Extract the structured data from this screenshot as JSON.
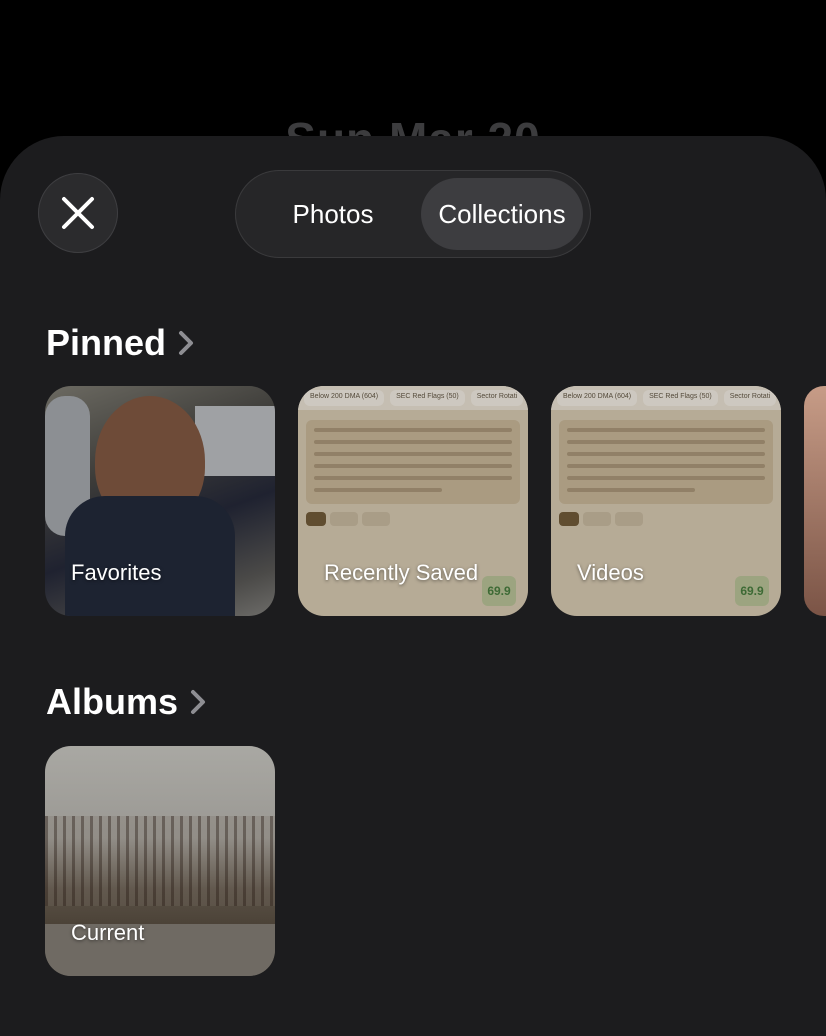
{
  "background": {
    "date_text": "Sun Mar 20"
  },
  "header": {
    "close_icon": "close-icon",
    "tabs": [
      {
        "label": "Photos",
        "selected": false
      },
      {
        "label": "Collections",
        "selected": true
      }
    ]
  },
  "pinned": {
    "title": "Pinned",
    "chevron_icon": "chevron-right-icon",
    "items": [
      {
        "label": "Favorites"
      },
      {
        "label": "Recently Saved"
      },
      {
        "label": "Videos"
      }
    ]
  },
  "thumb_doc": {
    "tabs": [
      "Below 200 DMA (604)",
      "SEC Red Flags (50)",
      "Sector Rotati"
    ],
    "score": "69.9"
  },
  "albums": {
    "title": "Albums",
    "chevron_icon": "chevron-right-icon",
    "items": [
      {
        "label": "Current"
      }
    ]
  },
  "colors": {
    "sheet": "#1c1c1e",
    "segment_selected": "#3d3d40",
    "text": "#ffffff"
  }
}
